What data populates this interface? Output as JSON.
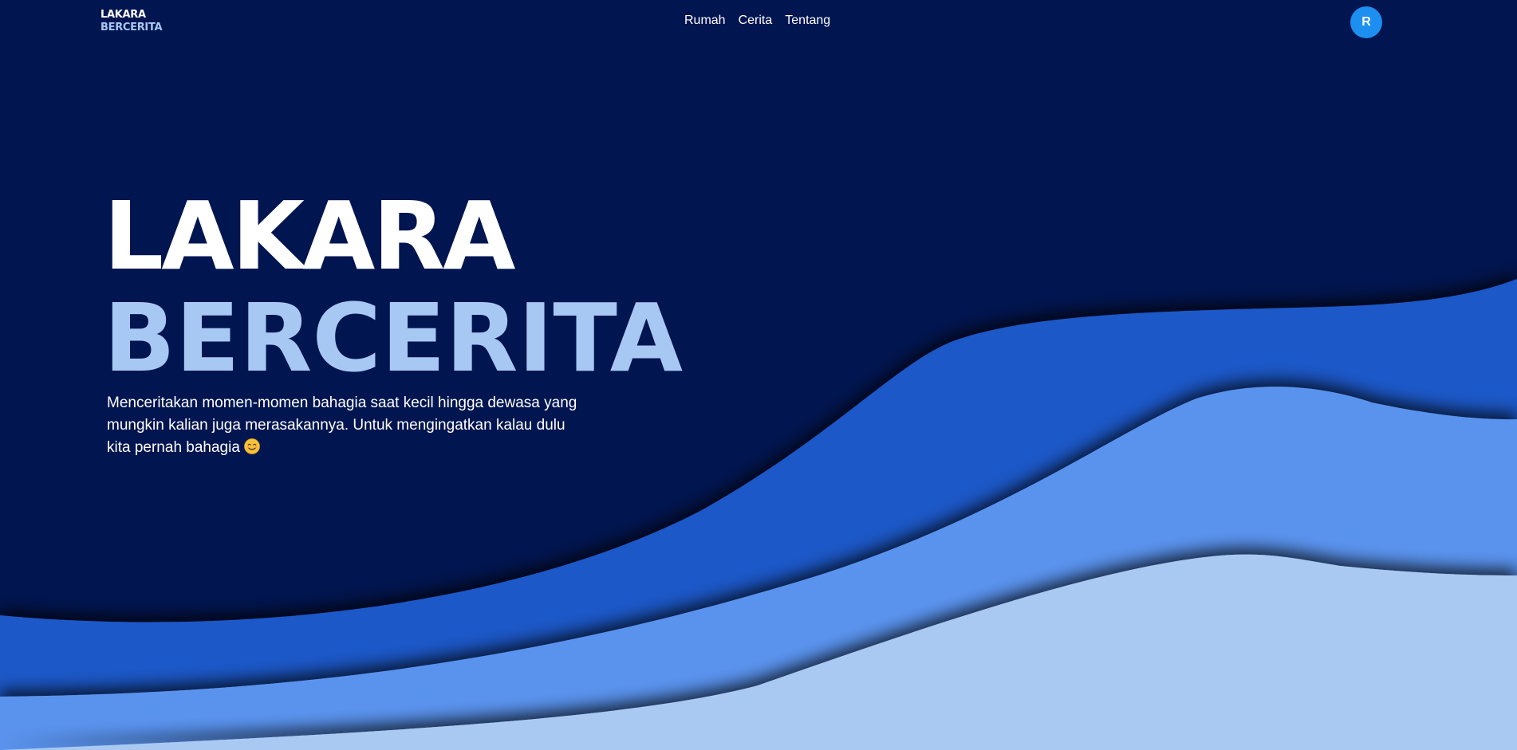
{
  "brand": {
    "line1": "LAKARA",
    "line2": "BERCERITA"
  },
  "nav": {
    "items": [
      {
        "label": "Rumah"
      },
      {
        "label": "Cerita"
      },
      {
        "label": "Tentang"
      }
    ]
  },
  "user": {
    "avatar_initial": "R",
    "avatar_color": "#1c8ff0"
  },
  "hero": {
    "title_line1": "LAKARA",
    "title_line2": "BERCERITA",
    "description": "Menceritakan momen-momen bahagia saat kecil hingga dewasa yang mungkin kalian juga merasakannya. Untuk mengingatkan kalau dulu kita pernah bahagia",
    "emoji_icon": "smiling-face-icon"
  },
  "colors": {
    "background": "#011550",
    "wave_dark": "#1e58c8",
    "wave_mid": "#5a93ee",
    "wave_light": "#a9c9f3",
    "accent_text": "#a8c8f4"
  }
}
